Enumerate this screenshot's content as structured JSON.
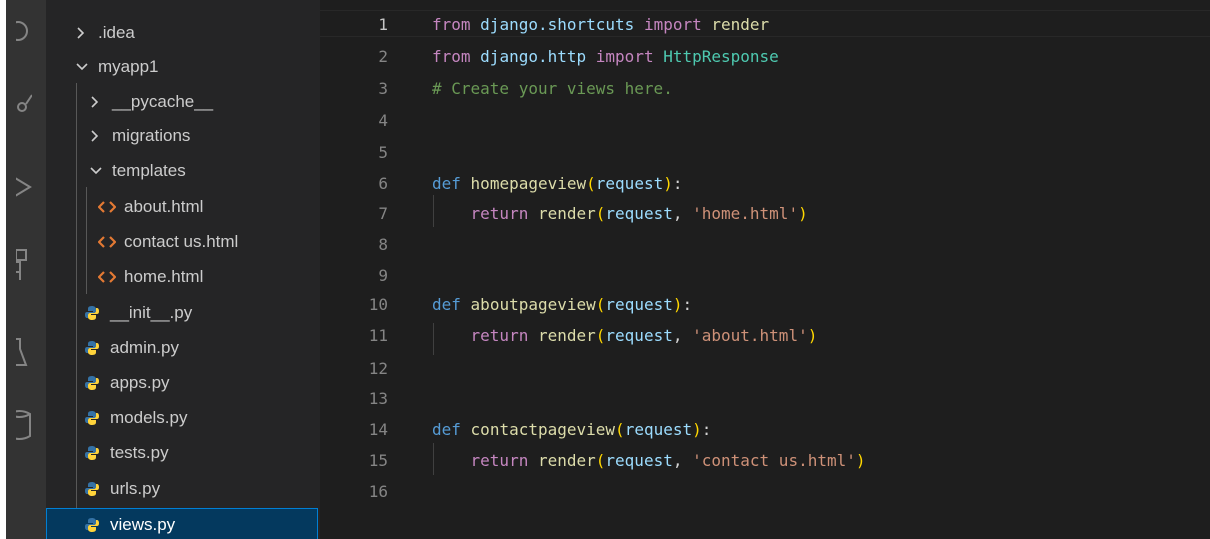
{
  "explorer": {
    "items": [
      {
        "label": ".idea",
        "kind": "folder",
        "expanded": false
      },
      {
        "label": "myapp1",
        "kind": "folder",
        "expanded": true
      },
      {
        "label": "__pycache__",
        "kind": "folder",
        "expanded": false
      },
      {
        "label": "migrations",
        "kind": "folder",
        "expanded": false
      },
      {
        "label": "templates",
        "kind": "folder",
        "expanded": true
      },
      {
        "label": "about.html",
        "kind": "html"
      },
      {
        "label": "contact us.html",
        "kind": "html"
      },
      {
        "label": "home.html",
        "kind": "html"
      },
      {
        "label": "__init__.py",
        "kind": "python"
      },
      {
        "label": "admin.py",
        "kind": "python"
      },
      {
        "label": "apps.py",
        "kind": "python"
      },
      {
        "label": "models.py",
        "kind": "python"
      },
      {
        "label": "tests.py",
        "kind": "python"
      },
      {
        "label": "urls.py",
        "kind": "python"
      },
      {
        "label": "views.py",
        "kind": "python",
        "selected": true
      }
    ]
  },
  "editor": {
    "line_numbers": [
      "1",
      "2",
      "3",
      "4",
      "5",
      "6",
      "7",
      "8",
      "9",
      "10",
      "11",
      "12",
      "13",
      "14",
      "15",
      "16"
    ],
    "active_line": "1",
    "lines": [
      [
        {
          "t": "from",
          "c": "kw"
        },
        {
          "t": " "
        },
        {
          "t": "django.shortcuts",
          "c": "id"
        },
        {
          "t": " "
        },
        {
          "t": "import",
          "c": "kw"
        },
        {
          "t": " "
        },
        {
          "t": "render",
          "c": "fn"
        }
      ],
      [
        {
          "t": "from",
          "c": "kw"
        },
        {
          "t": " "
        },
        {
          "t": "django.http",
          "c": "id"
        },
        {
          "t": " "
        },
        {
          "t": "import",
          "c": "kw"
        },
        {
          "t": " "
        },
        {
          "t": "HttpResponse",
          "c": "cls"
        }
      ],
      [
        {
          "t": "# Create your views here.",
          "c": "cm"
        }
      ],
      [],
      [],
      [
        {
          "t": "def",
          "c": "def"
        },
        {
          "t": " "
        },
        {
          "t": "homepageview",
          "c": "fn"
        },
        {
          "t": "(",
          "c": "p1"
        },
        {
          "t": "request",
          "c": "id"
        },
        {
          "t": ")",
          "c": "p1"
        },
        {
          "t": ":",
          "c": "pl"
        }
      ],
      [
        {
          "t": "    "
        },
        {
          "t": "return",
          "c": "kw"
        },
        {
          "t": " "
        },
        {
          "t": "render",
          "c": "fn"
        },
        {
          "t": "(",
          "c": "p1"
        },
        {
          "t": "request",
          "c": "id"
        },
        {
          "t": ", ",
          "c": "pl"
        },
        {
          "t": "'home.html'",
          "c": "str"
        },
        {
          "t": ")",
          "c": "p1"
        }
      ],
      [],
      [],
      [
        {
          "t": "def",
          "c": "def"
        },
        {
          "t": " "
        },
        {
          "t": "aboutpageview",
          "c": "fn"
        },
        {
          "t": "(",
          "c": "p1"
        },
        {
          "t": "request",
          "c": "id"
        },
        {
          "t": ")",
          "c": "p1"
        },
        {
          "t": ":",
          "c": "pl"
        }
      ],
      [
        {
          "t": "    "
        },
        {
          "t": "return",
          "c": "kw"
        },
        {
          "t": " "
        },
        {
          "t": "render",
          "c": "fn"
        },
        {
          "t": "(",
          "c": "p1"
        },
        {
          "t": "request",
          "c": "id"
        },
        {
          "t": ", ",
          "c": "pl"
        },
        {
          "t": "'about.html'",
          "c": "str"
        },
        {
          "t": ")",
          "c": "p1"
        }
      ],
      [],
      [],
      [
        {
          "t": "def",
          "c": "def"
        },
        {
          "t": " "
        },
        {
          "t": "contactpageview",
          "c": "fn"
        },
        {
          "t": "(",
          "c": "p1"
        },
        {
          "t": "request",
          "c": "id"
        },
        {
          "t": ")",
          "c": "p1"
        },
        {
          "t": ":",
          "c": "pl"
        }
      ],
      [
        {
          "t": "    "
        },
        {
          "t": "return",
          "c": "kw"
        },
        {
          "t": " "
        },
        {
          "t": "render",
          "c": "fn"
        },
        {
          "t": "(",
          "c": "p1"
        },
        {
          "t": "request",
          "c": "id"
        },
        {
          "t": ", ",
          "c": "pl"
        },
        {
          "t": "'contact us.html'",
          "c": "str"
        },
        {
          "t": ")",
          "c": "p1"
        }
      ],
      []
    ]
  },
  "activity_bar": {
    "icons": [
      "search-icon",
      "source-control-icon",
      "run-debug-icon",
      "extensions-icon",
      "testing-icon",
      "database-icon"
    ]
  },
  "theme": {
    "editor_bg": "#1e1e1e",
    "sidebar_bg": "#252526",
    "selection_border": "#007fd4",
    "html_icon": "#e37933",
    "python_icon_blue": "#3572a5",
    "python_icon_yellow": "#ffd43b"
  }
}
